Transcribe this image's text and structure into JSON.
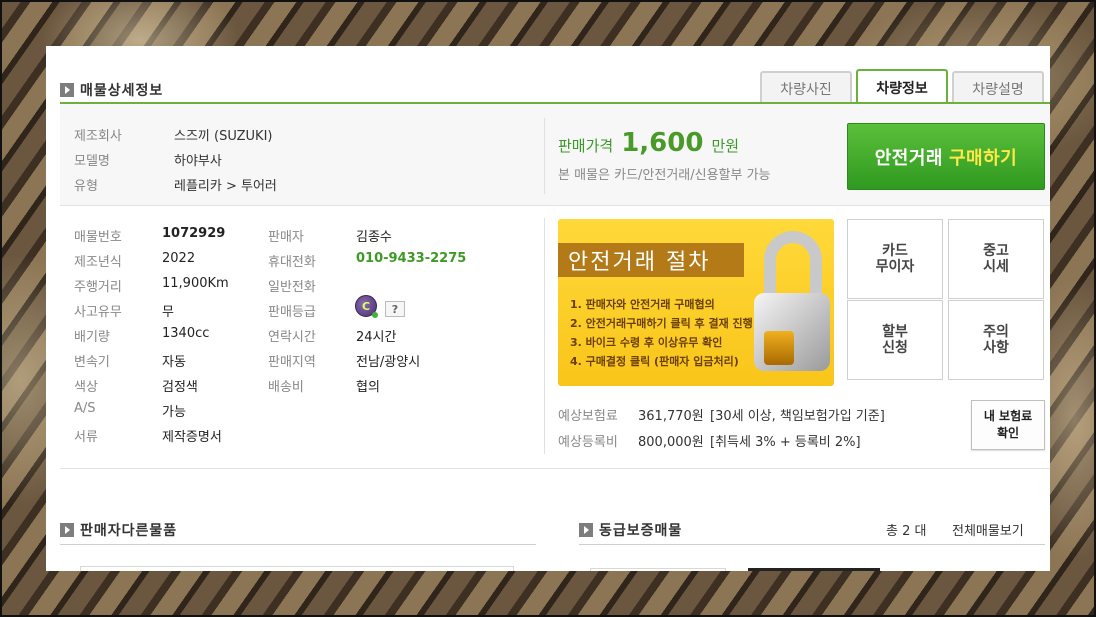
{
  "section_title": "매물상세정보",
  "tabs": [
    "차량사진",
    "차량정보",
    "차량설명"
  ],
  "active_tab": "차량정보",
  "vehicle": {
    "rows": [
      {
        "label": "제조회사",
        "value": "스즈끼 (SUZUKI)"
      },
      {
        "label": "모델명",
        "value": "하야부사"
      },
      {
        "label": "유형",
        "value": "레플리카 > 투어러"
      }
    ]
  },
  "price": {
    "label": "판매가격",
    "amount": "1,600",
    "unit": "만원",
    "note": "본 매물은 카드/안전거래/신용할부 가능"
  },
  "buy_button": {
    "part1": "안전거래",
    "part2": "구매하기"
  },
  "details_left": [
    {
      "label": "매물번호",
      "value": "1072929"
    },
    {
      "label": "제조년식",
      "value": "2022"
    },
    {
      "label": "주행거리",
      "value": "11,900Km"
    },
    {
      "label": "사고유무",
      "value": "무"
    },
    {
      "label": "배기량",
      "value": "1340cc"
    },
    {
      "label": "변속기",
      "value": "자동"
    },
    {
      "label": "색상",
      "value": "검정색"
    },
    {
      "label": "A/S",
      "value": "가능"
    },
    {
      "label": "서류",
      "value": "제작증명서"
    }
  ],
  "details_right": [
    {
      "label": "판매자",
      "value": "김종수"
    },
    {
      "label": "휴대전화",
      "value": "010-9433-2275"
    },
    {
      "label": "일반전화",
      "value": ""
    },
    {
      "label": "판매등급",
      "value": ""
    },
    {
      "label": "연락시간",
      "value": "24시간"
    },
    {
      "label": "판매지역",
      "value": "전남/광양시"
    },
    {
      "label": "배송비",
      "value": "협의"
    }
  ],
  "grade_icon_letter": "C",
  "help_icon_text": "?",
  "procedure": {
    "title": "안전거래 절차",
    "steps": [
      "1. 판매자와 안전거래 구매협의",
      "2. 안전거래구매하기 클릭 후 결재 진행",
      "3. 바이크 수령 후 이상유무 확인",
      "4. 구매결정 클릭 (판매자 입금처리)"
    ]
  },
  "grid_buttons": [
    [
      "카드",
      "무이자"
    ],
    [
      "중고",
      "시세"
    ],
    [
      "할부",
      "신청"
    ],
    [
      "주의",
      "사항"
    ]
  ],
  "insurance": {
    "premium_label": "예상보험료",
    "premium_value": "361,770원",
    "premium_note": "[30세 이상, 책임보험가입 기준]",
    "reg_label": "예상등록비",
    "reg_value": "800,000원",
    "reg_note": "[취득세 3% + 등록비 2%]",
    "button_line1": "내 보험료",
    "button_line2": "확인"
  },
  "seller_other_title": "판매자다른물품",
  "same_grade_title": "동급보증매물",
  "same_grade_count": "총 2 대",
  "view_all": "전체매물보기",
  "colors": {
    "accent_green": "#6ab23c",
    "price_green": "#4a9a2a",
    "banner_yellow": "#f9c51a"
  }
}
